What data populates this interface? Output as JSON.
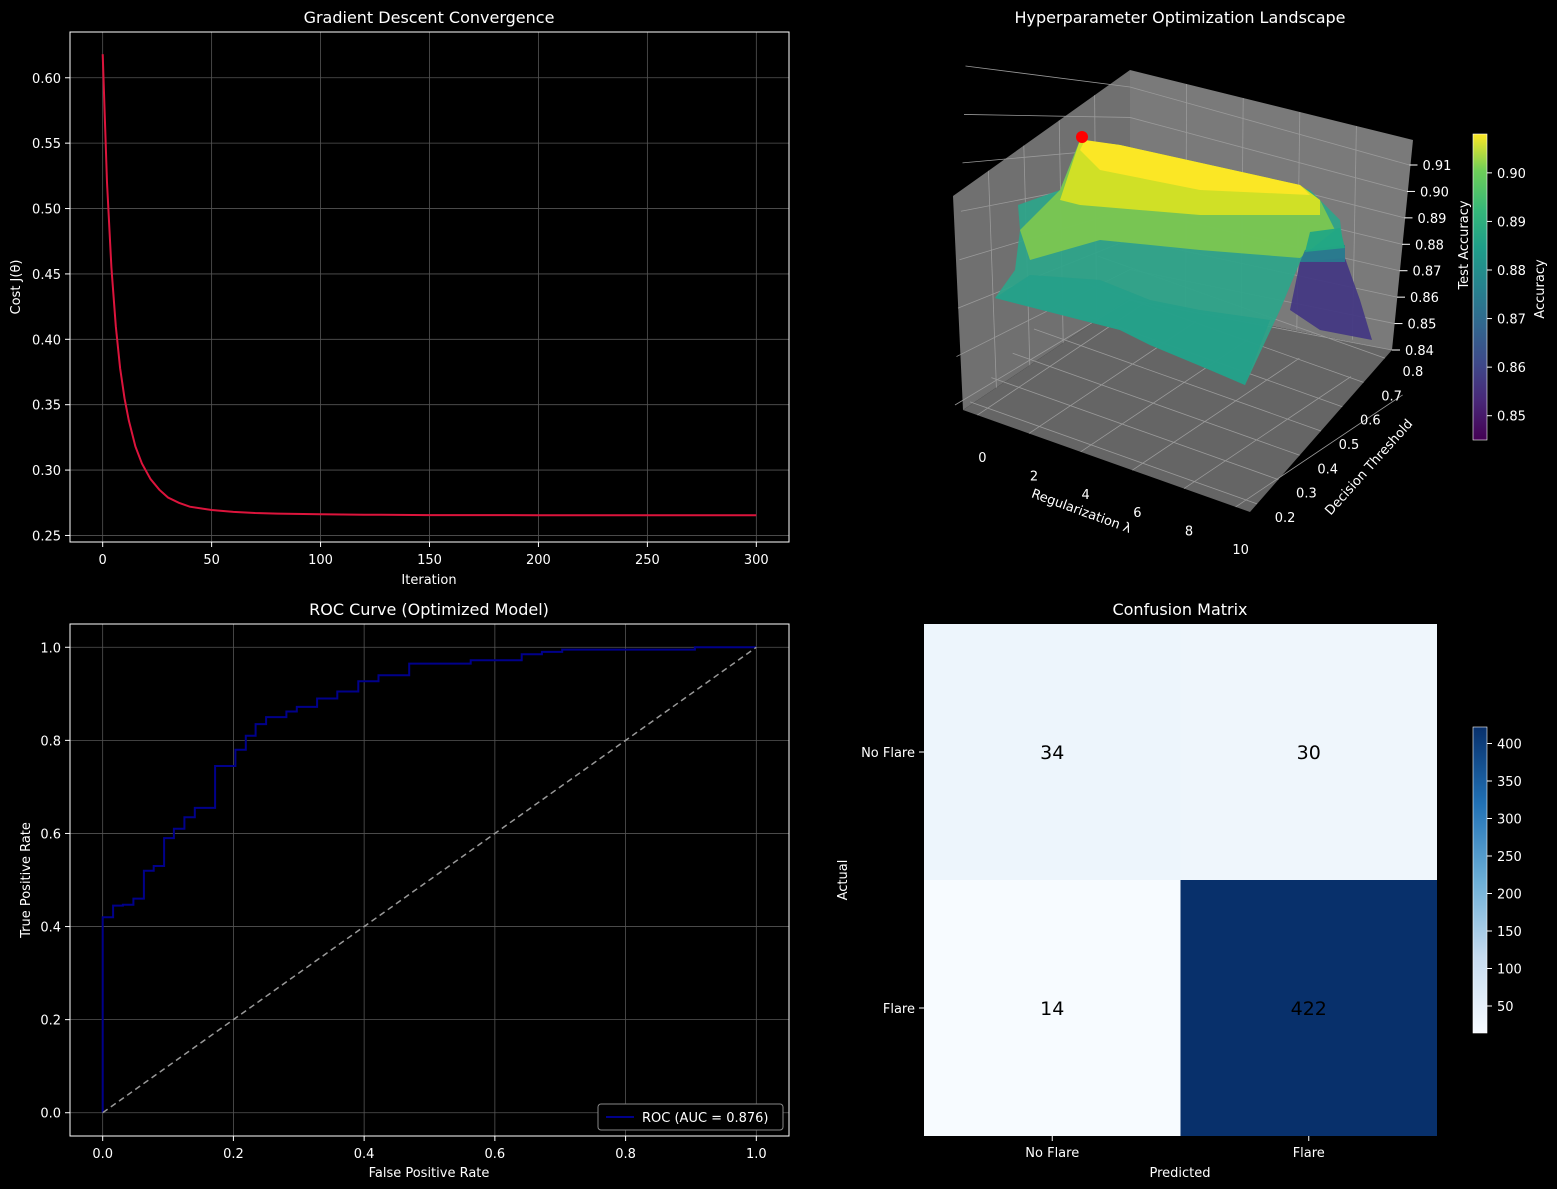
{
  "chart_data": [
    {
      "type": "line",
      "title": "Gradient Descent Convergence",
      "xlabel": "Iteration",
      "ylabel": "Cost J(θ)",
      "xlim": [
        -15,
        315
      ],
      "ylim": [
        0.245,
        0.635
      ],
      "xticks": [
        0,
        50,
        100,
        150,
        200,
        250,
        300
      ],
      "yticks": [
        0.25,
        0.3,
        0.35,
        0.4,
        0.45,
        0.5,
        0.55,
        0.6
      ],
      "grid": true,
      "series": [
        {
          "color": "#dc143c",
          "x": [
            0,
            2,
            4,
            6,
            8,
            10,
            12,
            15,
            18,
            22,
            26,
            30,
            35,
            40,
            50,
            60,
            70,
            80,
            100,
            120,
            150,
            200,
            250,
            300
          ],
          "y": [
            0.618,
            0.52,
            0.455,
            0.41,
            0.378,
            0.355,
            0.338,
            0.318,
            0.305,
            0.293,
            0.285,
            0.279,
            0.275,
            0.272,
            0.2695,
            0.268,
            0.2672,
            0.2667,
            0.2662,
            0.2659,
            0.2656,
            0.2655,
            0.2654,
            0.2654
          ]
        }
      ]
    },
    {
      "type": "surface3d",
      "title": "Hyperparameter Optimization Landscape",
      "xlabel": "Regularization λ",
      "ylabel": "Decision Threshold",
      "zlabel": "Test Accuracy",
      "xticks": [
        "0",
        "2",
        "4",
        "6",
        "8",
        "10"
      ],
      "yticks": [
        "0.2",
        "0.3",
        "0.4",
        "0.5",
        "0.6",
        "0.7",
        "0.8"
      ],
      "zticks": [
        "0.84",
        "0.85",
        "0.86",
        "0.87",
        "0.88",
        "0.89",
        "0.90",
        "0.91"
      ],
      "colorbar": {
        "label": "Accuracy",
        "ticks": [
          "0.85",
          "0.86",
          "0.87",
          "0.88",
          "0.89",
          "0.90"
        ],
        "range": [
          0.845,
          0.908
        ]
      },
      "optimum_marker_color": "#ff0000"
    },
    {
      "type": "line",
      "title": "ROC Curve (Optimized Model)",
      "xlabel": "False Positive Rate",
      "ylabel": "True Positive Rate",
      "xlim": [
        -0.05,
        1.05
      ],
      "ylim": [
        -0.05,
        1.05
      ],
      "xticks": [
        0.0,
        0.2,
        0.4,
        0.6,
        0.8,
        1.0
      ],
      "yticks": [
        0.0,
        0.2,
        0.4,
        0.6,
        0.8,
        1.0
      ],
      "grid": true,
      "legend": {
        "label": "ROC (AUC = 0.876)",
        "position": "lower-right"
      },
      "series": [
        {
          "name": "ROC (AUC = 0.876)",
          "color": "#00008b",
          "x": [
            0,
            0,
            0.016,
            0.016,
            0.031,
            0.031,
            0.047,
            0.047,
            0.063,
            0.063,
            0.078,
            0.078,
            0.094,
            0.094,
            0.109,
            0.109,
            0.125,
            0.125,
            0.141,
            0.141,
            0.172,
            0.172,
            0.203,
            0.203,
            0.219,
            0.219,
            0.234,
            0.234,
            0.25,
            0.25,
            0.281,
            0.281,
            0.297,
            0.297,
            0.328,
            0.328,
            0.359,
            0.359,
            0.391,
            0.391,
            0.422,
            0.422,
            0.469,
            0.469,
            0.563,
            0.563,
            0.641,
            0.641,
            0.672,
            0.672,
            0.703,
            0.703,
            0.906,
            0.906,
            1.0
          ],
          "y": [
            0,
            0.42,
            0.42,
            0.445,
            0.445,
            0.447,
            0.447,
            0.46,
            0.46,
            0.52,
            0.52,
            0.53,
            0.53,
            0.59,
            0.59,
            0.61,
            0.61,
            0.635,
            0.635,
            0.655,
            0.655,
            0.745,
            0.745,
            0.78,
            0.78,
            0.81,
            0.81,
            0.835,
            0.835,
            0.85,
            0.85,
            0.862,
            0.862,
            0.872,
            0.872,
            0.89,
            0.89,
            0.905,
            0.905,
            0.927,
            0.927,
            0.94,
            0.94,
            0.965,
            0.965,
            0.972,
            0.972,
            0.985,
            0.985,
            0.99,
            0.99,
            0.995,
            0.995,
            1.0,
            1.0
          ]
        },
        {
          "color": "#999999",
          "dashed": true,
          "x": [
            0,
            1
          ],
          "y": [
            0,
            1
          ]
        }
      ]
    },
    {
      "type": "heatmap",
      "title": "Confusion Matrix",
      "xlabel": "Predicted",
      "ylabel": "Actual",
      "x_categories": [
        "No Flare",
        "Flare"
      ],
      "y_categories": [
        "No Flare",
        "Flare"
      ],
      "values": [
        [
          34,
          30
        ],
        [
          14,
          422
        ]
      ],
      "colorbar": {
        "ticks": [
          50,
          100,
          150,
          200,
          250,
          300,
          350,
          400
        ],
        "range": [
          14,
          422
        ]
      }
    }
  ]
}
